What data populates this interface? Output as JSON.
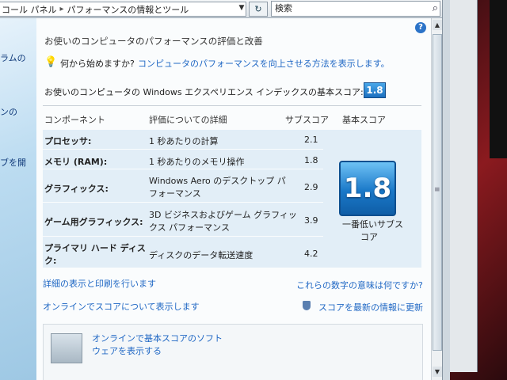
{
  "address_bar": {
    "crumbs": [
      "コール パネル",
      "パフォーマンスの情報とツール"
    ],
    "separator": "▸"
  },
  "search": {
    "placeholder": "検索"
  },
  "left_pane": {
    "fragments": [
      "ラムの",
      "ンの",
      "ブを開"
    ]
  },
  "main": {
    "title": "お使いのコンピュータのパフォーマンスの評価と改善",
    "tip_prefix": "何から始めますか?",
    "tip_link": "コンピュータのパフォーマンスを向上させる方法を表示します。",
    "base_score_label": "お使いのコンピュータの Windows エクスペリエンス インデックスの基本スコア:",
    "base_score": "1.8",
    "columns": {
      "component": "コンポーネント",
      "details": "評価についての詳細",
      "subscore": "サブスコア",
      "basescore": "基本スコア"
    },
    "rows": [
      {
        "component": "プロセッサ:",
        "details": [
          "1 秒あたりの計算"
        ],
        "subscore": "2.1"
      },
      {
        "component": "メモリ (RAM):",
        "details": [
          "1 秒あたりのメモリ操作"
        ],
        "subscore": "1.8"
      },
      {
        "component": "グラフィックス:",
        "details": [
          "Windows Aero のデスクトップ パ",
          "フォーマンス"
        ],
        "subscore": "2.9"
      },
      {
        "component": "ゲーム用グラフィックス:",
        "details": [
          "3D ビジネスおよびゲーム グラフィッ",
          "クス パフォーマンス"
        ],
        "subscore": "3.9"
      },
      {
        "component": [
          "プライマリ ハード ディス",
          "ク:"
        ],
        "details": [
          "ディスクのデータ転送速度"
        ],
        "subscore": "4.2"
      }
    ],
    "big_score": "1.8",
    "big_score_caption": [
      "一番低いサブス",
      "コア"
    ],
    "link_details_print": "詳細の表示と印刷を行います",
    "link_meaning": "これらの数字の意味は何ですか?",
    "link_online_score": "オンラインでスコアについて表示します",
    "link_update_score": "スコアを最新の情報に更新",
    "box_text": [
      "オンラインで基本スコアのソフト",
      "ウェアを表示する"
    ]
  },
  "colors": {
    "accent": "#1f67c4",
    "score_blue": "#1a78c8"
  },
  "icons": [
    "refresh-icon",
    "search-icon",
    "help-icon",
    "lightbulb-icon",
    "shield-icon",
    "software-box-icon"
  ]
}
